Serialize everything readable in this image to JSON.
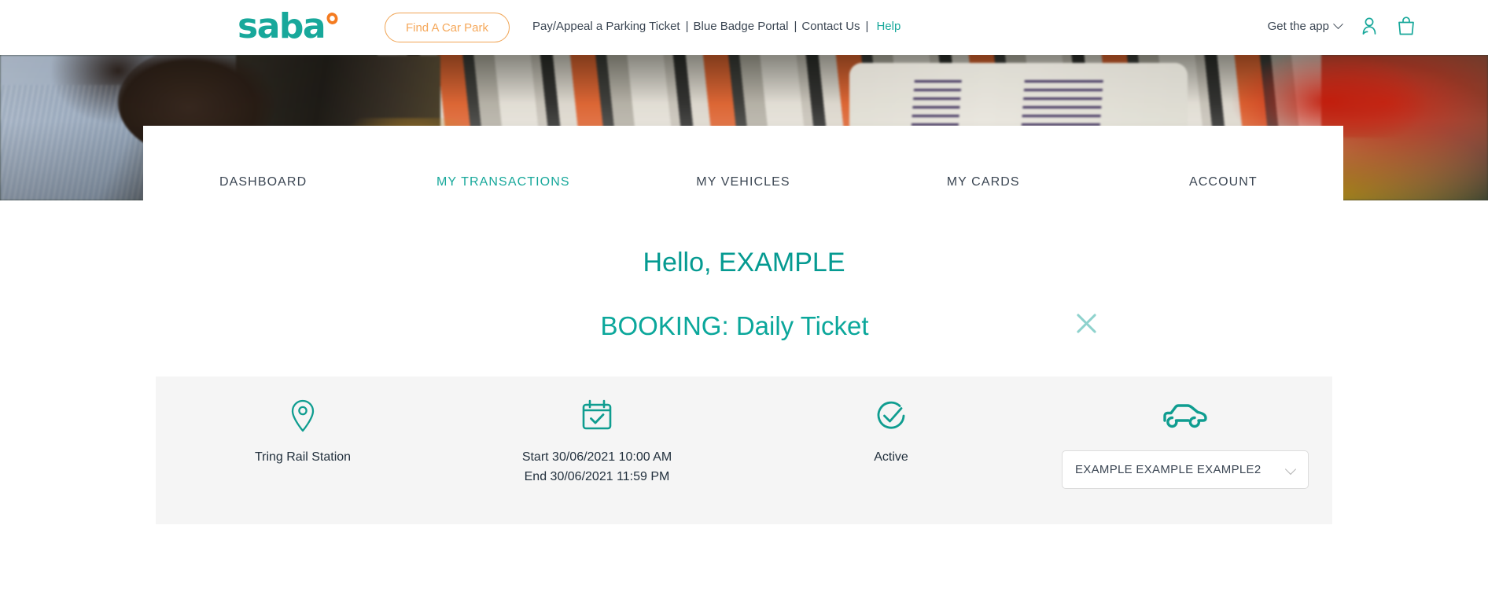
{
  "header": {
    "logo_text": "saba",
    "find_car_park_label": "Find A Car Park",
    "links": [
      {
        "label": "Pay/Appeal a Parking Ticket",
        "sep": "|"
      },
      {
        "label": "Blue Badge Portal",
        "sep": "|"
      },
      {
        "label": "Contact Us",
        "sep": "|"
      }
    ],
    "help_label": "Help",
    "get_the_app_label": "Get the app",
    "account_icon": "person-icon",
    "basket_icon": "shopping-bag-icon",
    "colors": {
      "brand_teal": "#18a89b",
      "brand_orange": "#f47b20",
      "nav_dark": "#3c4654"
    }
  },
  "tabs": [
    {
      "label": "DASHBOARD",
      "active": false
    },
    {
      "label": "MY TRANSACTIONS",
      "active": true
    },
    {
      "label": "MY VEHICLES",
      "active": false
    },
    {
      "label": "MY CARDS",
      "active": false
    },
    {
      "label": "ACCOUNT",
      "active": false
    }
  ],
  "main": {
    "greeting": "Hello, EXAMPLE",
    "booking_title": "BOOKING: Daily Ticket",
    "close_icon": "close-icon"
  },
  "booking_card": {
    "location": {
      "icon": "location-pin-icon",
      "label": "Tring Rail Station"
    },
    "dates": {
      "icon": "calendar-check-icon",
      "start_label": "Start 30/06/2021 10:00 AM",
      "end_label": "End 30/06/2021 11:59 PM"
    },
    "status": {
      "icon": "check-circle-icon",
      "label": "Active"
    },
    "vehicle": {
      "icon": "car-icon",
      "selected_value": "EXAMPLE EXAMPLE EXAMPLE2",
      "chevron_icon": "chevron-down-icon"
    }
  }
}
